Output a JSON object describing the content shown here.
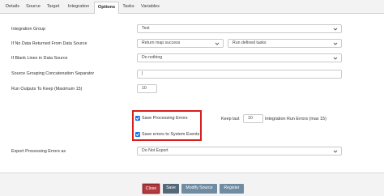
{
  "tabs": [
    "Details",
    "Source",
    "Target",
    "Integration",
    "Options",
    "Tasks",
    "Variables"
  ],
  "form": {
    "integration_group": {
      "label": "Integration Group",
      "value": "Test"
    },
    "no_data": {
      "label": "If No Data Returned From Data Source",
      "value": "Return map success",
      "value2": "Run defined tasks"
    },
    "blank_lines": {
      "label": "If Blank Lines in Data Source",
      "value": "Do nothing"
    },
    "concat_sep": {
      "label": "Source Grouping Concatenation Separator",
      "value": "|"
    },
    "run_outputs": {
      "label": "Run Outputs To Keep (Maximum 15)",
      "value": "10"
    },
    "save_processing_errors": {
      "label": "Save Processing Errors",
      "checked": true
    },
    "save_system_events": {
      "label": "Save errors to System Events",
      "checked": true
    },
    "keep_last": {
      "label": "Keep last",
      "value": "10",
      "suffix": "Integration Run Errors (max 15)"
    },
    "export_errors": {
      "label": "Export Processing Errors as",
      "value": "Do Not Export"
    }
  },
  "buttons": {
    "close": "Close",
    "save": "Save",
    "modify": "Modify Source",
    "register": "Register"
  },
  "colors": {
    "highlight": "#d91e1e",
    "checkbox": "#1a73e8",
    "close_button": "#b13a3f"
  }
}
